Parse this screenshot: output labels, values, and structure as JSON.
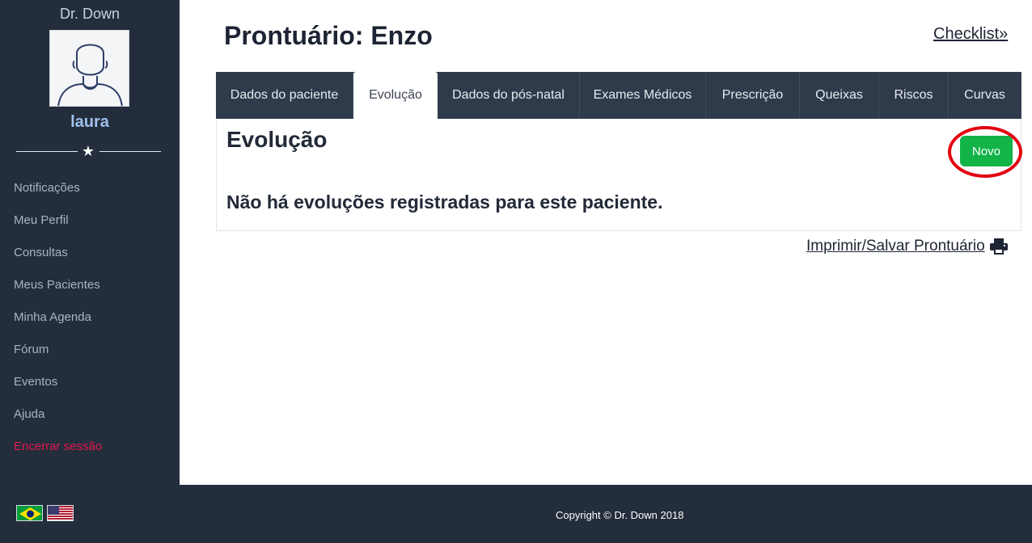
{
  "sidebar": {
    "brand": "Dr. Down",
    "username": "laura",
    "items": [
      {
        "label": "Notificações",
        "name": "sidebar-item-notificacoes"
      },
      {
        "label": "Meu Perfil",
        "name": "sidebar-item-meu-perfil"
      },
      {
        "label": "Consultas",
        "name": "sidebar-item-consultas"
      },
      {
        "label": "Meus Pacientes",
        "name": "sidebar-item-meus-pacientes"
      },
      {
        "label": "Minha Agenda",
        "name": "sidebar-item-minha-agenda"
      },
      {
        "label": "Fórum",
        "name": "sidebar-item-forum"
      },
      {
        "label": "Eventos",
        "name": "sidebar-item-eventos"
      },
      {
        "label": "Ajuda",
        "name": "sidebar-item-ajuda"
      },
      {
        "label": "Encerrar sessão",
        "name": "sidebar-item-encerrar-sessao"
      }
    ]
  },
  "header": {
    "title": "Prontuário: Enzo",
    "checklist_label": "Checklist",
    "checklist_icon": "double-chevron-right-icon"
  },
  "tabs": [
    {
      "label": "Dados do paciente",
      "active": false
    },
    {
      "label": "Evolução",
      "active": true
    },
    {
      "label": "Dados do pós-natal",
      "active": false
    },
    {
      "label": "Exames Médicos",
      "active": false
    },
    {
      "label": "Prescrição",
      "active": false
    },
    {
      "label": "Queixas",
      "active": false
    },
    {
      "label": "Riscos",
      "active": false
    },
    {
      "label": "Curvas",
      "active": false
    }
  ],
  "panel": {
    "title": "Evolução",
    "new_button": "Novo",
    "empty_message": "Não há evoluções registradas para este paciente."
  },
  "print_link": {
    "label": "Imprimir/Salvar Prontuário",
    "icon": "printer-icon"
  },
  "footer": {
    "copyright": "Copyright © Dr. Down 2018",
    "flags": [
      "brazil-flag-icon",
      "usa-flag-icon"
    ]
  },
  "colors": {
    "sidebar_bg": "#232d3b",
    "tabs_bg": "#2f3a4a",
    "accent_green": "#12b447",
    "highlight_red": "#e3000f",
    "logout_red": "#e0184f",
    "username_blue": "#9fc1ee"
  }
}
